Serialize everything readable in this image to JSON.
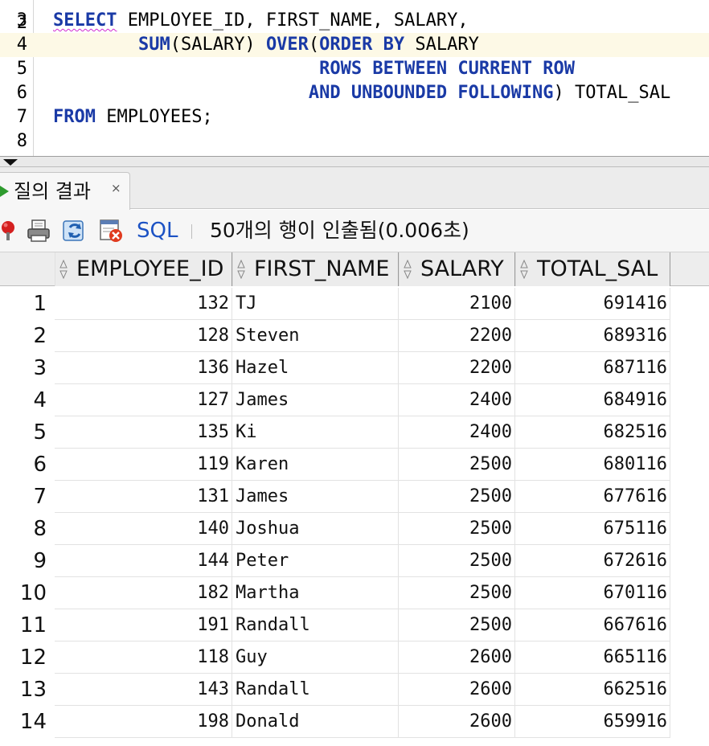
{
  "editor": {
    "line2_number": "2",
    "lines": [
      {
        "number": "3",
        "parts": [
          {
            "t": "SELECT",
            "kw": true,
            "squiggle": true
          },
          {
            "t": " EMPLOYEE_ID, FIRST_NAME, SALARY,",
            "kw": false
          }
        ]
      },
      {
        "number": "4",
        "current": true,
        "parts": [
          {
            "t": "        ",
            "kw": false
          },
          {
            "t": "SUM",
            "kw": true
          },
          {
            "t": "(SALARY) ",
            "kw": false
          },
          {
            "t": "OVER",
            "kw": true
          },
          {
            "t": "(",
            "kw": false
          },
          {
            "t": "ORDER BY",
            "kw": true
          },
          {
            "t": " SALARY",
            "kw": false
          }
        ]
      },
      {
        "number": "5",
        "parts": [
          {
            "t": "                         ",
            "kw": false
          },
          {
            "t": "ROWS BETWEEN CURRENT ROW",
            "kw": true
          }
        ]
      },
      {
        "number": "6",
        "parts": [
          {
            "t": "                        ",
            "kw": false
          },
          {
            "t": "AND UNBOUNDED FOLLOWING",
            "kw": true
          },
          {
            "t": ") TOTAL_SAL",
            "kw": false
          }
        ]
      },
      {
        "number": "7",
        "parts": [
          {
            "t": "FROM",
            "kw": true
          },
          {
            "t": " EMPLOYEES;",
            "kw": false
          }
        ]
      },
      {
        "number": "8",
        "parts": []
      }
    ]
  },
  "tab": {
    "label": "질의 결과",
    "close": "×"
  },
  "toolbar": {
    "sql_label": "SQL",
    "status": "50개의 행이 인출됨(0.006초)",
    "icons": [
      "pin-icon",
      "print-icon",
      "refresh-icon",
      "delete-icon"
    ]
  },
  "grid": {
    "columns": [
      "EMPLOYEE_ID",
      "FIRST_NAME",
      "SALARY",
      "TOTAL_SAL"
    ],
    "rows": [
      {
        "n": "1",
        "employee_id": "132",
        "first_name": "TJ",
        "salary": "2100",
        "total_sal": "691416"
      },
      {
        "n": "2",
        "employee_id": "128",
        "first_name": "Steven",
        "salary": "2200",
        "total_sal": "689316"
      },
      {
        "n": "3",
        "employee_id": "136",
        "first_name": "Hazel",
        "salary": "2200",
        "total_sal": "687116"
      },
      {
        "n": "4",
        "employee_id": "127",
        "first_name": "James",
        "salary": "2400",
        "total_sal": "684916"
      },
      {
        "n": "5",
        "employee_id": "135",
        "first_name": "Ki",
        "salary": "2400",
        "total_sal": "682516"
      },
      {
        "n": "6",
        "employee_id": "119",
        "first_name": "Karen",
        "salary": "2500",
        "total_sal": "680116"
      },
      {
        "n": "7",
        "employee_id": "131",
        "first_name": "James",
        "salary": "2500",
        "total_sal": "677616"
      },
      {
        "n": "8",
        "employee_id": "140",
        "first_name": "Joshua",
        "salary": "2500",
        "total_sal": "675116"
      },
      {
        "n": "9",
        "employee_id": "144",
        "first_name": "Peter",
        "salary": "2500",
        "total_sal": "672616"
      },
      {
        "n": "10",
        "employee_id": "182",
        "first_name": "Martha",
        "salary": "2500",
        "total_sal": "670116"
      },
      {
        "n": "11",
        "employee_id": "191",
        "first_name": "Randall",
        "salary": "2500",
        "total_sal": "667616"
      },
      {
        "n": "12",
        "employee_id": "118",
        "first_name": "Guy",
        "salary": "2600",
        "total_sal": "665116"
      },
      {
        "n": "13",
        "employee_id": "143",
        "first_name": "Randall",
        "salary": "2600",
        "total_sal": "662516"
      },
      {
        "n": "14",
        "employee_id": "198",
        "first_name": "Donald",
        "salary": "2600",
        "total_sal": "659916"
      }
    ]
  }
}
